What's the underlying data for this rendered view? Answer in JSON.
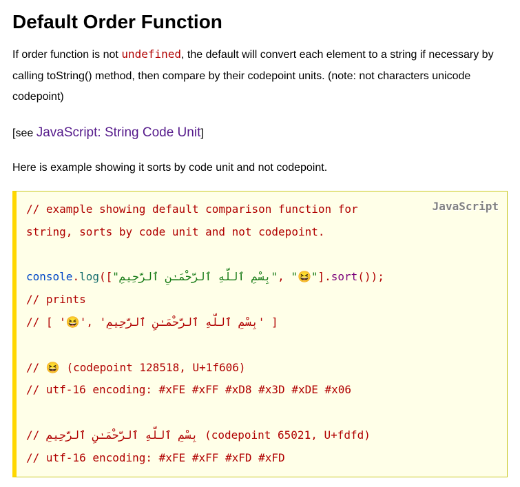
{
  "heading": "Default Order Function",
  "intro_part1": "If order function is not ",
  "intro_inline": "undefined",
  "intro_part2": ", the default will convert each element to a string if necessary by calling toString() method, then compare by their codepoint units. (note: not characters unicode codepoint)",
  "see_prefix": "[see ",
  "see_link": "JavaScript: String Code Unit",
  "see_suffix": "]",
  "example_intro": "Here is example showing it sorts by code unit and not codepoint.",
  "code_lang": "JavaScript",
  "code": {
    "c1a": "// example showing default comparison function for",
    "c1b": "string, sorts by code unit and not codepoint.",
    "blank1": "",
    "log1": "console",
    "log2": ".",
    "log3": "log",
    "log4": "([",
    "log5": "\"بِسْمِ ٱللَّهِ ٱلرَّحْمَـٰنِ ٱلرَّحِيمِ\"",
    "log6": ", ",
    "log7": "\"😆\"",
    "log8": "].",
    "log9": "sort",
    "log10": "());",
    "c2": "// prints",
    "c3": "// [ '😆', 'بِسْمِ ٱللَّهِ ٱلرَّحْمَـٰنِ ٱلرَّحِيمِ' ]",
    "blank2": "",
    "c4": "// 😆 (codepoint 128518, U+1f606)",
    "c5": "// utf-16 encoding: #xFE #xFF #xD8 #x3D #xDE #x06",
    "blank3": "",
    "c6": "// بِسْمِ ٱللَّهِ ٱلرَّحْمَـٰنِ ٱلرَّحِيمِ (codepoint 65021, U+fdfd)",
    "c7": "// utf-16 encoding: #xFE #xFF #xFD #xFD"
  }
}
